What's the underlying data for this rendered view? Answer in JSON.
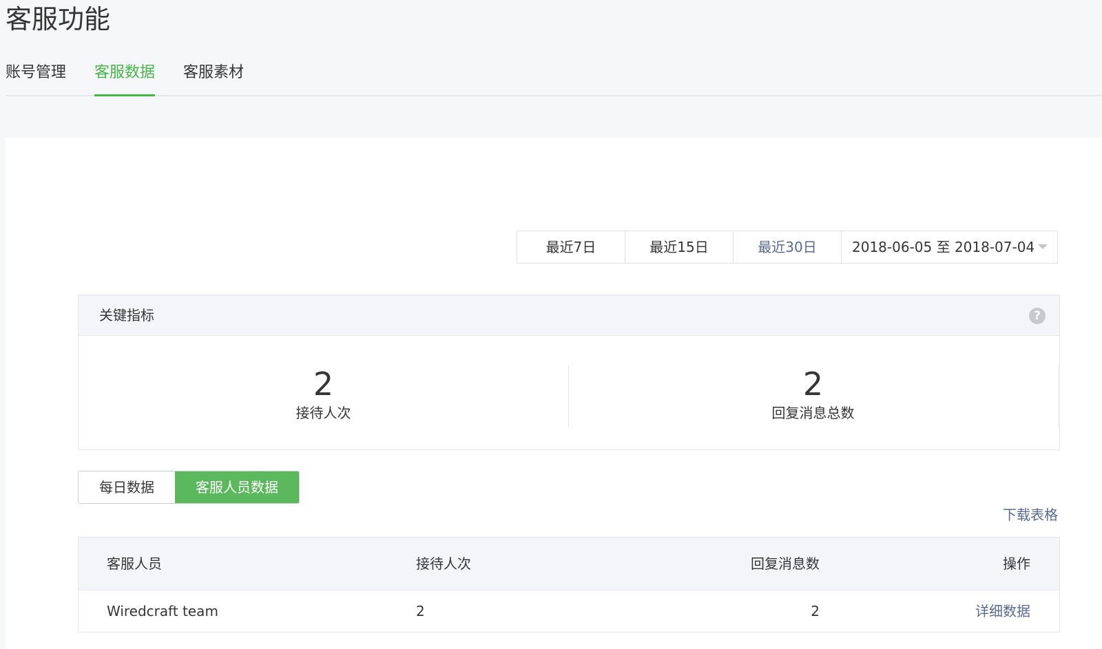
{
  "page_title": "客服功能",
  "tabs": [
    {
      "label": "账号管理",
      "active": false
    },
    {
      "label": "客服数据",
      "active": true
    },
    {
      "label": "客服素材",
      "active": false
    }
  ],
  "date_filter": {
    "options": [
      "最近7日",
      "最近15日",
      "最近30日"
    ],
    "selected": "最近30日",
    "range_text": "2018-06-05 至 2018-07-04"
  },
  "key_metrics": {
    "title": "关键指标",
    "items": [
      {
        "value": "2",
        "label": "接待人次"
      },
      {
        "value": "2",
        "label": "回复消息总数"
      }
    ]
  },
  "view_switch": {
    "options": [
      "每日数据",
      "客服人员数据"
    ],
    "selected": "客服人员数据"
  },
  "download_label": "下载表格",
  "table": {
    "headers": [
      "客服人员",
      "接待人次",
      "回复消息数",
      "操作"
    ],
    "rows": [
      {
        "agent": "Wiredcraft team",
        "sessions": "2",
        "replies": "2",
        "action": "详细数据"
      }
    ]
  },
  "colors": {
    "accent_green": "#44b549",
    "link_blue": "#576b95"
  }
}
